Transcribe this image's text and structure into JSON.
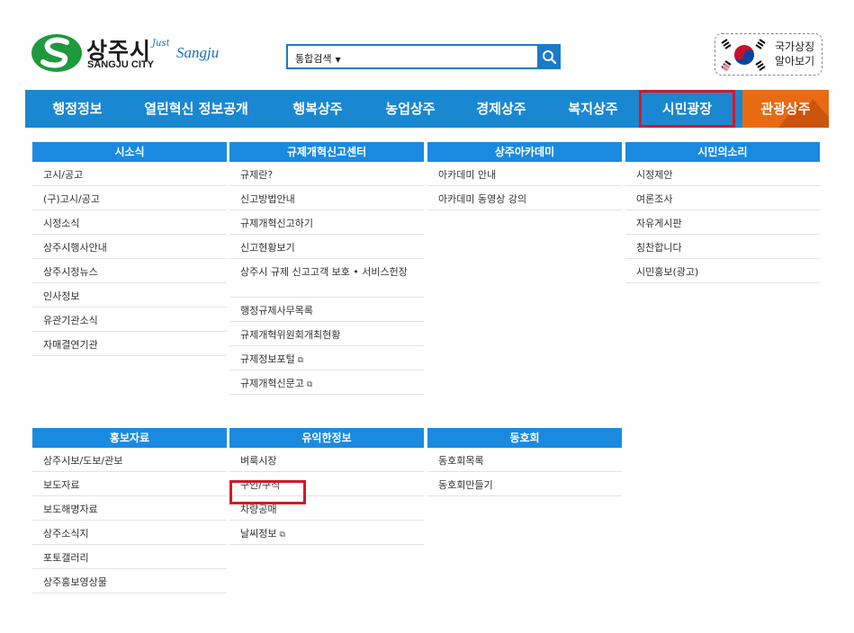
{
  "header": {
    "logo_kr": "상주시",
    "logo_en": "SANGJU CITY",
    "logo_tag_script": "Just",
    "logo_tag_name": "Sangju",
    "search_select_label": "통합검색",
    "symbol_line1": "국가상징",
    "symbol_line2": "알아보기"
  },
  "gnb": {
    "items": [
      "행정정보",
      "열린혁신 정보공개",
      "행복상주",
      "농업상주",
      "경제상주",
      "복지상주",
      "시민광장",
      "관광상주"
    ],
    "selected": "시민광장"
  },
  "submenu": {
    "row1": [
      {
        "title": "시소식",
        "items": [
          "고시/공고",
          "(구)고시/공고",
          "시정소식",
          "상주시행사안내",
          "상주시정뉴스",
          "인사정보",
          "유관기관소식",
          "자매결연기관"
        ]
      },
      {
        "title": "규제개혁신고센터",
        "items": [
          "규제란?",
          "신고방법안내",
          "규제개혁신고하기",
          "신고현황보기",
          "상주시 규제 신고고객 보호 • 서비스헌장",
          "행정규제사무목록",
          "규제개혁위원회개최현황",
          "규제정보포털",
          "규제개혁신문고"
        ]
      },
      {
        "title": "상주아카데미",
        "items": [
          "아카데미 안내",
          "아카데미 동영상 강의"
        ]
      },
      {
        "title": "시민의소리",
        "items": [
          "시정제안",
          "여론조사",
          "자유게시판",
          "칭찬합니다",
          "시민홍보(광고)"
        ]
      }
    ],
    "row2": [
      {
        "title": "홍보자료",
        "items": [
          "상주시보/도보/관보",
          "보도자료",
          "보도해명자료",
          "상주소식지",
          "포토갤러리",
          "상주홍보영상물"
        ]
      },
      {
        "title": "유익한정보",
        "items": [
          "벼룩시장",
          "구인/구직",
          "차량공매",
          "날씨정보"
        ]
      },
      {
        "title": "동호회",
        "items": [
          "동호회목록",
          "동호회만들기"
        ]
      }
    ],
    "external_marker": "⧉",
    "highlighted_item": "구인/구직"
  },
  "colors": {
    "gnb_bg": "#1a87d1",
    "col_head_bg": "#1a8ae0",
    "tourism_bg": "#e86a13",
    "highlight": "#d4182a",
    "logo_green": "#1e9a3c"
  }
}
